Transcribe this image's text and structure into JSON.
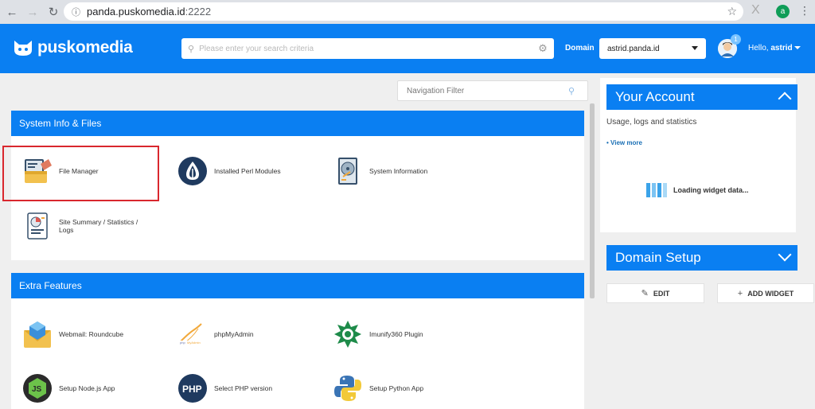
{
  "browser": {
    "url_host": "panda.puskomedia.id",
    "url_port": ":2222",
    "profile_initial": "a"
  },
  "header": {
    "brand": "puskomedia",
    "search_placeholder": "Please enter your search criteria",
    "domain_label": "Domain",
    "domain_value": "astrid.panda.id",
    "notification_count": "1",
    "greeting": "Hello,",
    "username": "astrid"
  },
  "nav_filter_placeholder": "Navigation Filter",
  "sections": [
    {
      "title": "System Info & Files",
      "items": [
        {
          "label": "File Manager",
          "icon": "file-manager-icon"
        },
        {
          "label": "Installed Perl Modules",
          "icon": "perl-onion-icon"
        },
        {
          "label": "System Information",
          "icon": "hard-drive-icon"
        },
        {
          "label": "Site Summary / Statistics / Logs",
          "icon": "report-icon"
        }
      ]
    },
    {
      "title": "Extra Features",
      "items": [
        {
          "label": "Webmail: Roundcube",
          "icon": "webmail-icon"
        },
        {
          "label": "phpMyAdmin",
          "icon": "phpmyadmin-icon"
        },
        {
          "label": "Imunify360 Plugin",
          "icon": "imunify-icon"
        },
        {
          "label": "Setup Node.js App",
          "icon": "nodejs-icon"
        },
        {
          "label": "Select PHP version",
          "icon": "php-icon"
        },
        {
          "label": "Setup Python App",
          "icon": "python-icon"
        }
      ]
    }
  ],
  "account": {
    "title": "Your Account",
    "subtitle": "Usage, logs and statistics",
    "view_more": "• View more",
    "loading_text": "Loading widget data..."
  },
  "domain_setup": {
    "title": "Domain Setup",
    "edit_label": "EDIT",
    "add_widget_label": "ADD WIDGET"
  },
  "colors": {
    "brand_blue": "#0a7ff2",
    "highlight_red": "#d9272e"
  }
}
